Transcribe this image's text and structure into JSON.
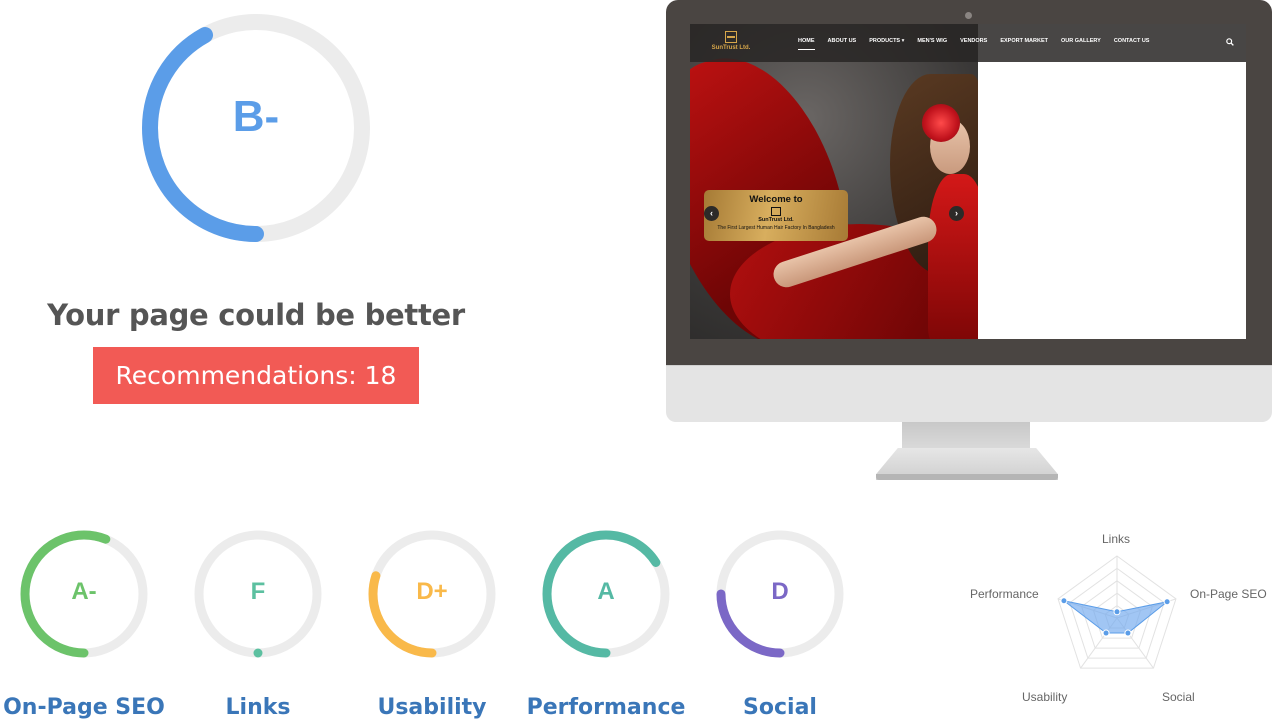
{
  "summary": {
    "grade": "B-",
    "score_fraction": 0.42,
    "headline": "Your page could be better",
    "recommendations_label": "Recommendations: 18",
    "ring_color": "#5b9de8",
    "badge_color": "#f25a55"
  },
  "preview": {
    "site": {
      "brand": "SunTrust Ltd.",
      "nav": [
        "HOME",
        "ABOUT US",
        "PRODUCTS ▾",
        "MEN'S WIG",
        "VENDORS",
        "EXPORT MARKET",
        "OUR GALLERY",
        "CONTACT US"
      ],
      "active_nav": "HOME",
      "slide": {
        "heading": "Welcome to",
        "brand": "SunTrust Ltd.",
        "tagline": "The First Largest Human Hair Factory In Bangladesh"
      }
    }
  },
  "categories": [
    {
      "id": "onpage",
      "label": "On-Page SEO",
      "grade": "A-",
      "fraction": 0.56,
      "color": "#6cc36a"
    },
    {
      "id": "links",
      "label": "Links",
      "grade": "F",
      "fraction": 0.0,
      "color": "#5cc0a0"
    },
    {
      "id": "usability",
      "label": "Usability",
      "grade": "D+",
      "fraction": 0.3,
      "color": "#f9b94a"
    },
    {
      "id": "performance",
      "label": "Performance",
      "grade": "A",
      "fraction": 0.66,
      "color": "#55b9a4"
    },
    {
      "id": "social",
      "label": "Social",
      "grade": "D",
      "fraction": 0.25,
      "color": "#7b68c6"
    }
  ],
  "radar": {
    "axes": [
      "Links",
      "On-Page SEO",
      "Social",
      "Usability",
      "Performance"
    ],
    "values": [
      0.1,
      0.85,
      0.3,
      0.3,
      0.9
    ],
    "fill_color": "#6fa8ee"
  }
}
